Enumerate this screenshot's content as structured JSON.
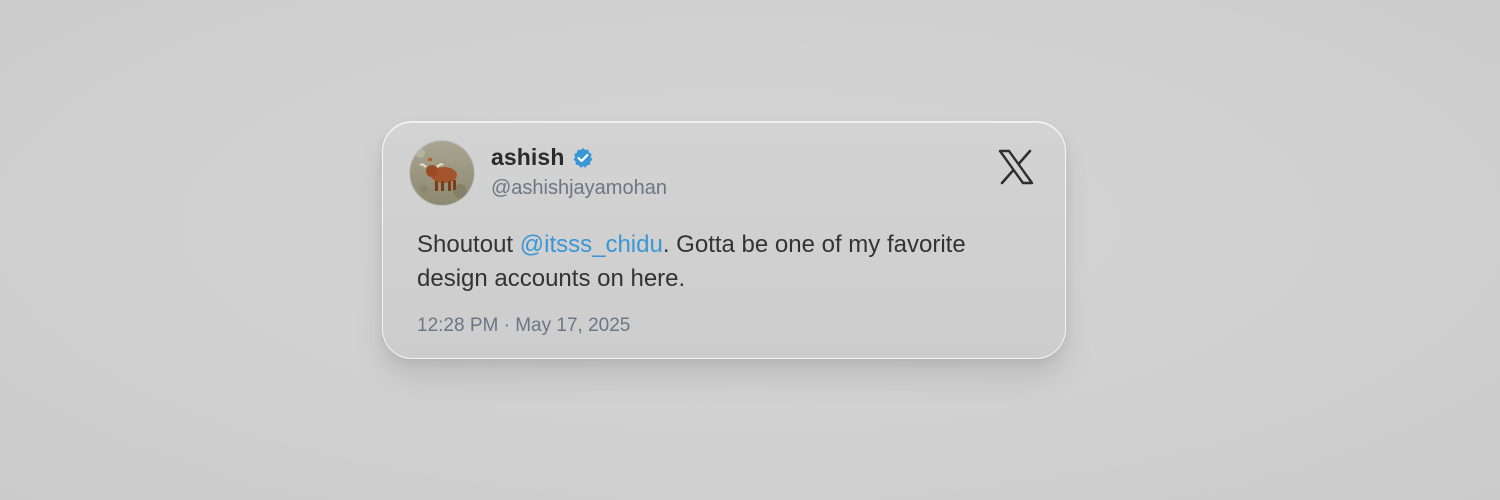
{
  "tweet": {
    "display_name": "ashish",
    "handle": "@ashishjayamohan",
    "text_before": "Shoutout ",
    "mention": "@itsss_chidu",
    "text_after": ". Gotta be one of my favorite design accounts on here.",
    "timestamp": "12:28 PM · May 17, 2025",
    "icons": {
      "verified": "verified-badge-icon",
      "platform": "x-logo-icon"
    },
    "colors": {
      "mention": "#3a97d6",
      "verified": "#3a97d6",
      "secondary_text": "#6b7785"
    }
  }
}
